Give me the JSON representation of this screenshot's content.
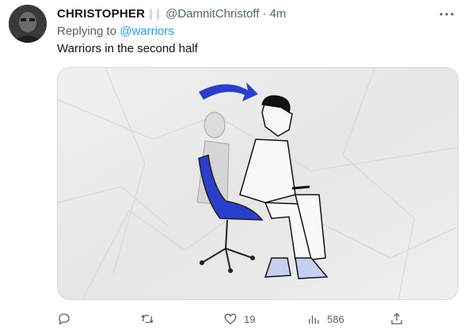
{
  "tweet": {
    "display_name": "CHRISTOPHER",
    "handle": "@DamnitChristoff",
    "separator": "·",
    "time": "4m",
    "replying_prefix": "Replying to ",
    "replying_to": "@warriors",
    "text": "Warriors in the second half",
    "image_icon": "cartoon-man-sliding-down-in-blue-chair"
  },
  "actions": {
    "reply_count": "",
    "retweet_count": "",
    "like_count": "19",
    "views_count": "586"
  },
  "colors": {
    "link": "#1d9bf0",
    "secondary_text": "#536471",
    "chair_blue": "#2a3fc9"
  }
}
